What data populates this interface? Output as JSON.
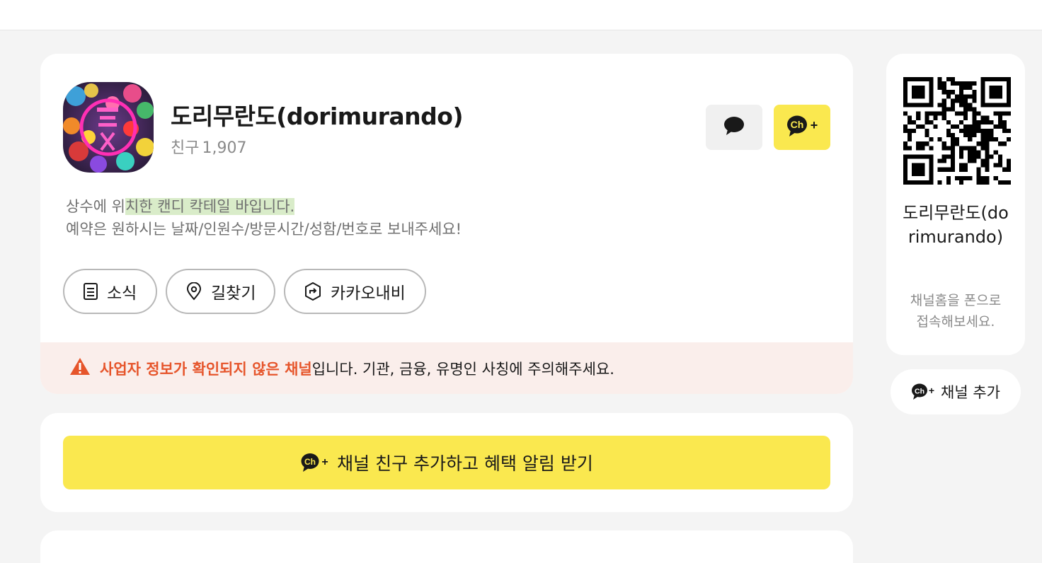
{
  "channel": {
    "name": "도리무란도(dorimurando)",
    "friends_label": "친구",
    "friends_count": "1,907",
    "description_line1_pre": "상수에 위",
    "description_line1_hl": "치한 캔디 칵테일 바입니다.",
    "description_line2": "예약은 원하시는 날짜/인원수/방문시간/성함/번호로 보내주세요!"
  },
  "actions": {
    "news": "소식",
    "directions": "길찾기",
    "kakaonavi": "카카오내비"
  },
  "warning": {
    "highlight": "사업자 정보가 확인되지 않은 채널",
    "rest": "입니다. 기관, 금융, 유명인 사칭에 주의해주세요."
  },
  "cta": {
    "label": "채널 친구 추가하고 혜택 알림 받기"
  },
  "sidebar": {
    "name": "도리무란도(dorimurando)",
    "hint": "채널홈을 폰으로 접속해보세요.",
    "add_label": "채널 추가"
  },
  "icons": {
    "chat": "speech-bubble-icon",
    "channel_plus": "channel-plus-icon",
    "news": "document-icon",
    "directions": "location-pin-icon",
    "navi": "navi-hexagon-icon",
    "warning": "warning-triangle-icon"
  },
  "colors": {
    "accent_yellow": "#fae84f",
    "warning_red": "#e6552b",
    "warning_bg": "#faeeeb",
    "text_gray": "#8a8a8a"
  }
}
